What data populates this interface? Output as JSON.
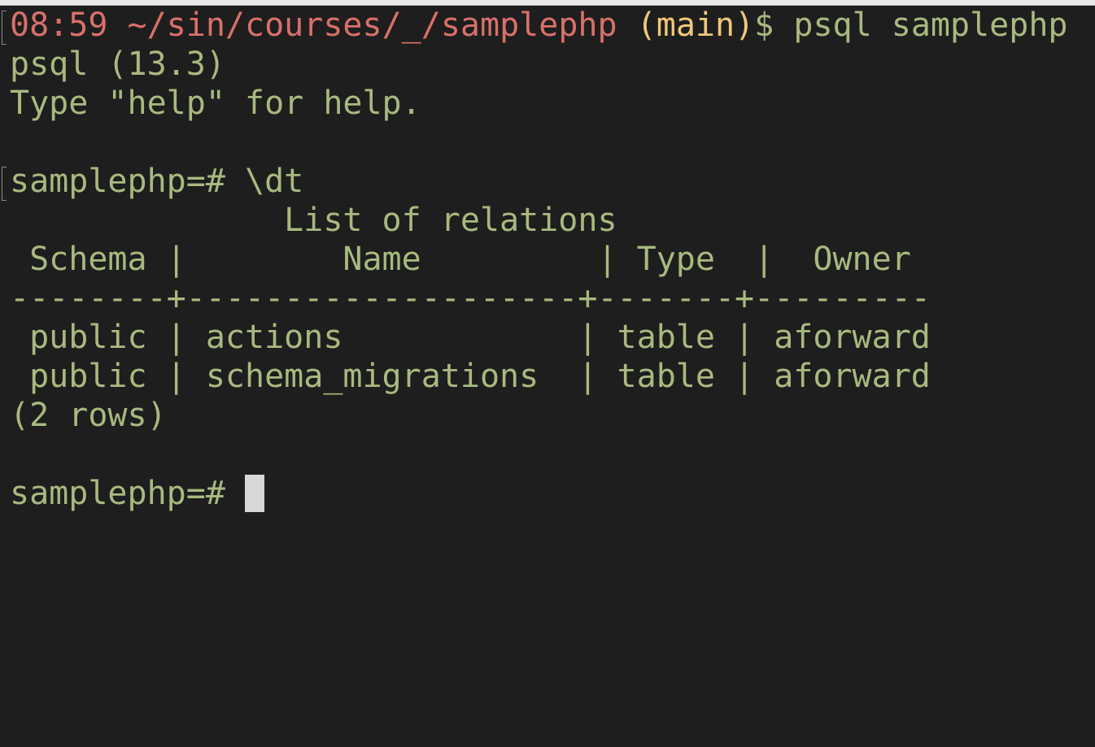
{
  "prompt": {
    "time": "08:59",
    "path": "~/sin/courses/_/samplephp",
    "branch": "(main)",
    "dollar": "$",
    "command": "psql samplephp"
  },
  "output": {
    "version_line": "psql (13.3)",
    "help_line": "Type \"help\" for help."
  },
  "psql": {
    "prompt": "samplephp=#",
    "command": "\\dt",
    "table_title": "              List of relations",
    "header_line": " Schema |        Name         | Type  |  Owner",
    "separator_line": "--------+--------------------+-------+---------",
    "rows": [
      " public | actions            | table | aforward",
      " public | schema_migrations  | table | aforward"
    ],
    "row_count": "(2 rows)",
    "final_prompt": "samplephp=#"
  },
  "colors": {
    "background": "#1e1e1e",
    "text": "#a8b97f",
    "path": "#d9706a",
    "branch": "#f1c879",
    "cursor": "#d7d7d7"
  }
}
